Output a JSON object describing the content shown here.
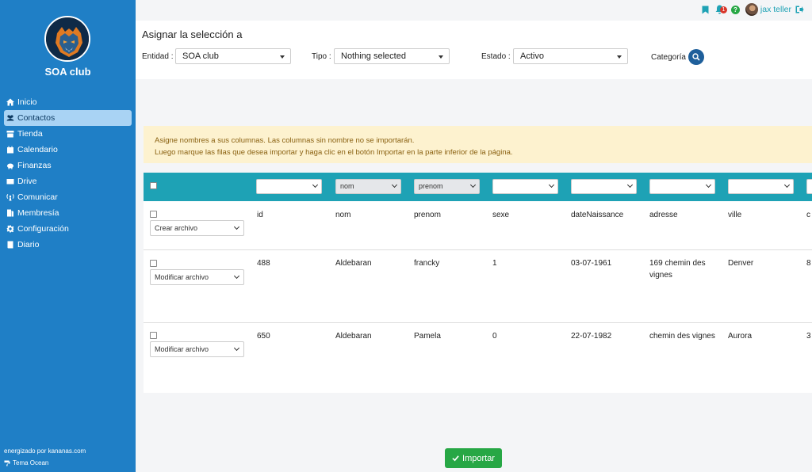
{
  "sidebar": {
    "club_name": "SOA club",
    "items": [
      {
        "label": "Inicio",
        "icon": "home-icon"
      },
      {
        "label": "Contactos",
        "icon": "users-icon"
      },
      {
        "label": "Tienda",
        "icon": "store-icon"
      },
      {
        "label": "Calendario",
        "icon": "calendar-icon"
      },
      {
        "label": "Finanzas",
        "icon": "piggy-bank-icon"
      },
      {
        "label": "Drive",
        "icon": "drive-icon"
      },
      {
        "label": "Comunicar",
        "icon": "broadcast-icon"
      },
      {
        "label": "Membresía",
        "icon": "membership-icon"
      },
      {
        "label": "Configuración",
        "icon": "gear-icon"
      },
      {
        "label": "Diario",
        "icon": "book-icon"
      }
    ],
    "active": "Contactos",
    "powered_by": "energizado por kananas.com",
    "theme": "Tema Ocean"
  },
  "topbar": {
    "notification_count": "1",
    "help": "?",
    "username": "jax teller"
  },
  "assign": {
    "title": "Asignar la selección a",
    "entidad_label": "Entidad :",
    "entidad_value": "SOA club",
    "tipo_label": "Tipo :",
    "tipo_value": "Nothing selected",
    "estado_label": "Estado :",
    "estado_value": "Activo",
    "categoria_label": "Categoría"
  },
  "alert": {
    "line1": "Asigne nombres a sus columnas. Las columnas sin nombre no se importarán.",
    "line2": "Luego marque las filas que desea importar y haga clic en el botón Importar en la parte inferior de la página."
  },
  "columns": [
    "",
    "nom",
    "prenom",
    "",
    "",
    "",
    ""
  ],
  "rows": [
    {
      "action": "Crear archivo",
      "cells": [
        "id",
        "nom",
        "prenom",
        "sexe",
        "dateNaissance",
        "adresse",
        "ville",
        "c"
      ]
    },
    {
      "action": "Modificar archivo",
      "cells": [
        "488",
        "Aldebaran",
        "francky",
        "1",
        "03-07-1961",
        "169 chemin des vignes",
        "Denver",
        "8"
      ]
    },
    {
      "action": "Modificar archivo",
      "cells": [
        "650",
        "Aldebaran",
        "Pamela",
        "0",
        "22-07-1982",
        "chemin des vignes",
        "Aurora",
        "3"
      ]
    }
  ],
  "import_label": "Importar",
  "colors": {
    "sidebar": "#1f7fc6",
    "teal": "#1ea2b5",
    "green": "#27a745",
    "alert_bg": "#fdf2cf"
  }
}
